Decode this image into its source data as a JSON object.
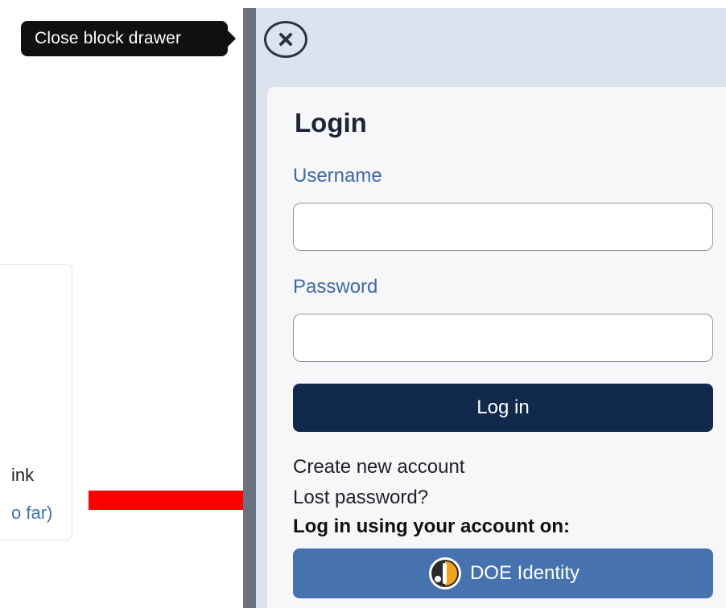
{
  "tooltip": {
    "text": "Close block drawer"
  },
  "left_page": {
    "text_1": "ink",
    "text_2": "o far)"
  },
  "drawer": {
    "close_icon": "close-icon",
    "login": {
      "title": "Login",
      "username_label": "Username",
      "username_value": "",
      "password_label": "Password",
      "password_value": "",
      "login_button": "Log in",
      "create_account": "Create new account",
      "lost_password": "Lost password?",
      "sso_heading": "Log in using your account on:",
      "sso_button": "DOE Identity"
    }
  },
  "colors": {
    "primary_button": "#112a4b",
    "sso_button": "#4673b0",
    "label": "#3f6aa6",
    "annotation_arrow": "#ff0000"
  }
}
